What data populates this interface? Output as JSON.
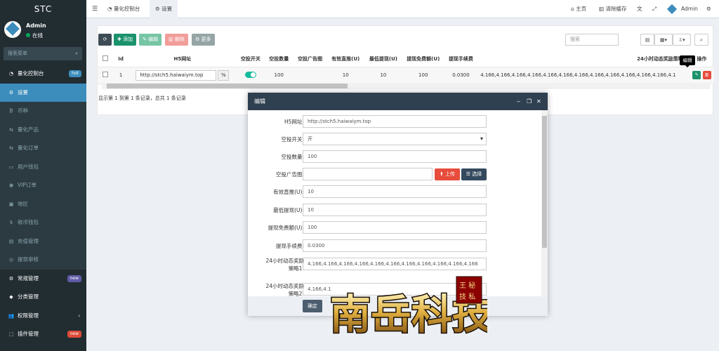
{
  "app": {
    "logo": "STC"
  },
  "user": {
    "name": "Admin",
    "status": "在线"
  },
  "sidebar": {
    "search_placeholder": "搜索菜单",
    "items": [
      {
        "label": "量化控制台",
        "badge": "hot",
        "icon": "dashboard-icon"
      },
      {
        "label": "设置",
        "icon": "gear-icon"
      },
      {
        "label": "币种",
        "icon": "bitcoin-icon"
      },
      {
        "label": "量化产品",
        "icon": "arrows-icon"
      },
      {
        "label": "量化订单",
        "icon": "arrows-icon"
      },
      {
        "label": "用户钱包",
        "icon": "wallet-icon"
      },
      {
        "label": "VIP订单",
        "icon": "vip-icon"
      },
      {
        "label": "地区",
        "icon": "region-icon"
      },
      {
        "label": "收币钱包",
        "icon": "dollar-icon"
      },
      {
        "label": "充值管理",
        "icon": "recharge-icon"
      },
      {
        "label": "提现审核",
        "icon": "withdraw-icon"
      },
      {
        "label": "常规管理",
        "badge": "new",
        "icon": "cogs-icon"
      },
      {
        "label": "分类管理",
        "icon": "category-icon"
      },
      {
        "label": "权限管理",
        "icon": "users-icon"
      },
      {
        "label": "插件管理",
        "badge": "new",
        "icon": "plugin-icon"
      }
    ]
  },
  "topbar": {
    "tabs": [
      "量化控制台",
      "设置"
    ],
    "home": "主页",
    "clear_cache": "清除缓存",
    "admin": "Admin"
  },
  "toolbar": {
    "add": "添加",
    "edit": "编辑",
    "delete": "删除",
    "more": "更多",
    "search_placeholder": "搜索"
  },
  "table": {
    "headers": [
      "Id",
      "H5网址",
      "空投开关",
      "空投数量",
      "空投广告图",
      "有效直推(U)",
      "最低提现(U)",
      "提现免费额(U)",
      "提现手续费",
      "24小时动态奖励策略1",
      "操作"
    ],
    "row": {
      "id": "1",
      "url": "http://stch5.haiwaiym.top",
      "airdrop_count": "100",
      "direct": "10",
      "min_withdraw": "10",
      "free_quota": "100",
      "fee": "0.0300",
      "strategy": "4.166,4.166,4.166,4.166,4.166,4.166,4.166,4.166,4.166,4.166,4.166,4.166,4.1"
    }
  },
  "pager": "显示第 1 到第 1 条记录，总共 1 条记录",
  "tooltip": "编辑",
  "modal": {
    "title": "编辑",
    "fields": [
      {
        "label": "H5网址:",
        "value": "http://stch5.haiwaiym.top"
      },
      {
        "label": "空投开关:",
        "value": "开"
      },
      {
        "label": "空投数量:",
        "value": "100"
      },
      {
        "label": "空投广告图:",
        "value": ""
      },
      {
        "label": "有效直推(U):",
        "value": "10"
      },
      {
        "label": "最低提现(U):",
        "value": "10"
      },
      {
        "label": "提现免费额(U):",
        "value": "100"
      },
      {
        "label": "提现手续费:",
        "value": "0.0300"
      },
      {
        "label": "24小时动态奖励",
        "label2": "策略1:",
        "value": "4.166,4.166,4.166,4.166,4.166,4.166,4.166,4.166,4.166,4.166,4.166"
      },
      {
        "label": "24小时动态奖励",
        "label2": "策略2:",
        "value": "4.166,4.1"
      }
    ],
    "upload": "上传",
    "choose": "选择",
    "ok": "确定"
  },
  "watermark": {
    "main": "南岳科技",
    "seal": "王 秘 技 私"
  }
}
